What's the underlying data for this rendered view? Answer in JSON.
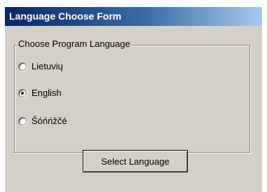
{
  "window": {
    "title": "Language Choose Form"
  },
  "group": {
    "legend": "Choose Program Language"
  },
  "options": [
    {
      "label": "Lietuvių",
      "selected": false
    },
    {
      "label": "English",
      "selected": true
    },
    {
      "label": "Šóńńžčé",
      "selected": false
    }
  ],
  "button": {
    "label": "Select Language"
  },
  "colors": {
    "titlebar_start": "#0a246a",
    "titlebar_end": "#a6caf0",
    "client_background": "#d4d0c8"
  }
}
